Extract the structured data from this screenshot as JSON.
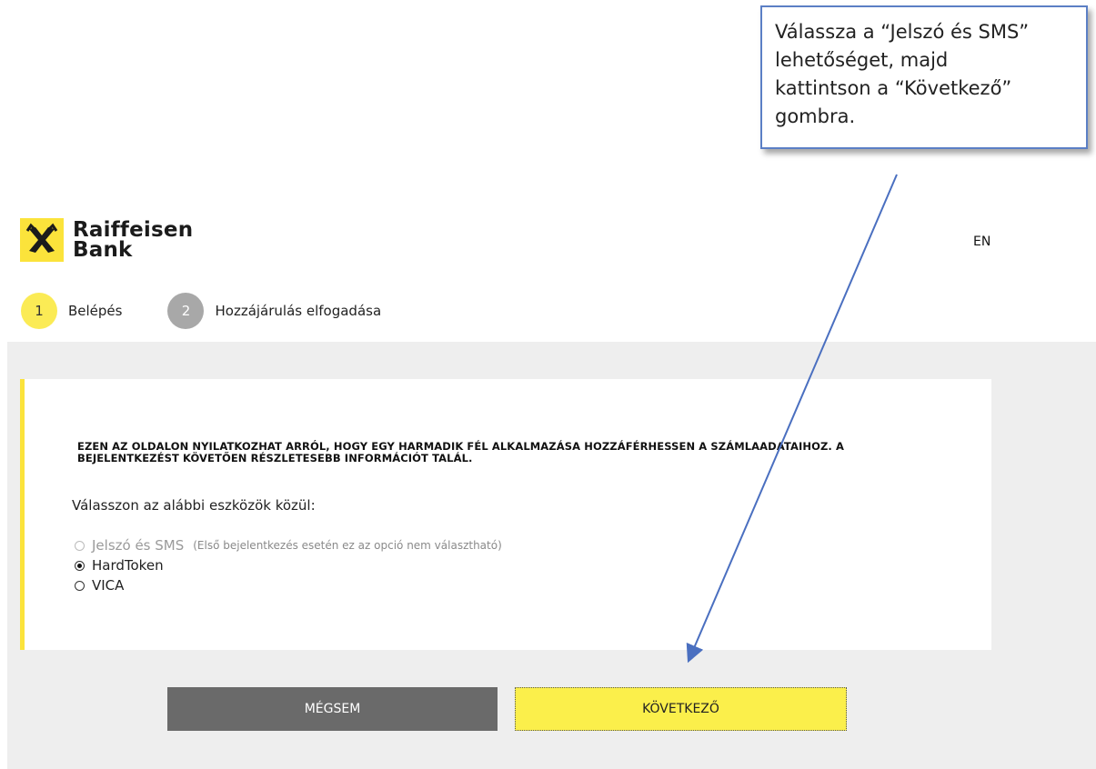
{
  "callout": {
    "lines": [
      "Válassza a “Jelszó és SMS”",
      "lehetőséget, majd",
      "kattintson a “Következő”",
      "gombra."
    ]
  },
  "header": {
    "brand_line1": "Raiffeisen",
    "brand_line2": "Bank",
    "language_link": "EN"
  },
  "steps": [
    {
      "number": "1",
      "label": "Belépés",
      "state": "active"
    },
    {
      "number": "2",
      "label": "Hozzájárulás elfogadása",
      "state": "inactive"
    }
  ],
  "main": {
    "notice_line1": "EZEN AZ OLDALON NYILATKOZHAT ARRÓL, HOGY EGY HARMADIK FÉL ALKALMAZÁSA HOZZÁFÉRHESSEN A SZÁMLAADATAIHOZ. A",
    "notice_line2": "BEJELENTKEZÉST KÖVETŐEN RÉSZLETESEBB INFORMÁCIÓT TALÁL.",
    "prompt": "Válasszon az alábbi eszközök közül:",
    "options": [
      {
        "label": "Jelszó és SMS",
        "note": "(Első bejelentkezés esetén ez az opció nem választható)",
        "disabled": true,
        "checked": false
      },
      {
        "label": "HardToken",
        "note": "",
        "disabled": false,
        "checked": true
      },
      {
        "label": "VICA",
        "note": "",
        "disabled": false,
        "checked": false
      }
    ]
  },
  "buttons": {
    "cancel": "MÉGSEM",
    "next": "KÖVETKEZŐ"
  },
  "colors": {
    "brand_yellow": "#fbe33b",
    "callout_border": "#5b7fc5",
    "cancel_bg": "#6a6a6a",
    "next_bg": "#fbef4b"
  }
}
